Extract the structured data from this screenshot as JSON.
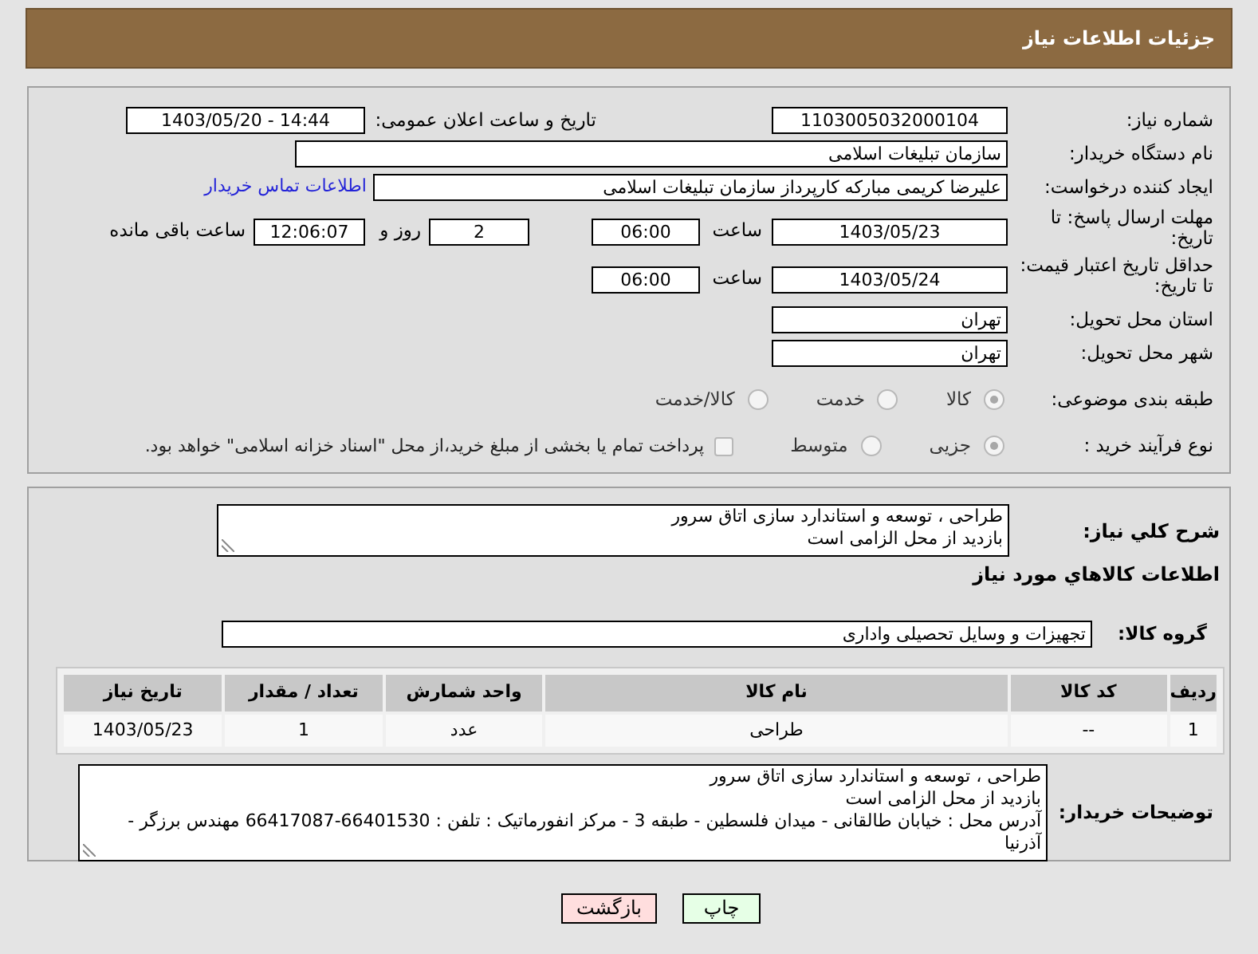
{
  "header": {
    "title": "جزئیات اطلاعات نیاز"
  },
  "need_number": {
    "label": "شماره نیاز:",
    "value": "1103005032000104"
  },
  "announce": {
    "label": "تاریخ و ساعت اعلان عمومی:",
    "value": "1403/05/20 - 14:44"
  },
  "buyer_org": {
    "label": "نام دستگاه خریدار:",
    "value": "سازمان تبلیغات اسلامی"
  },
  "requester": {
    "label": "ایجاد کننده درخواست:",
    "value": "علیرضا کریمی مبارکه کارپرداز سازمان تبلیغات اسلامی",
    "link": "اطلاعات تماس خریدار"
  },
  "reply_deadline": {
    "label": "مهلت ارسال پاسخ: تا تاریخ:",
    "date": "1403/05/23",
    "time_label": "ساعت",
    "time": "06:00",
    "days": "2",
    "days_label": "روز و",
    "remaining": "12:06:07",
    "remaining_label": "ساعت باقی مانده"
  },
  "price_validity": {
    "label": "حداقل تاریخ اعتبار قیمت: تا تاریخ:",
    "date": "1403/05/24",
    "time_label": "ساعت",
    "time": "06:00"
  },
  "province": {
    "label": "استان محل تحویل:",
    "value": "تهران"
  },
  "city": {
    "label": "شهر محل تحویل:",
    "value": "تهران"
  },
  "category": {
    "label": "طبقه بندی موضوعی:",
    "options": [
      {
        "label": "کالا",
        "selected": true
      },
      {
        "label": "خدمت",
        "selected": false
      },
      {
        "label": "کالا/خدمت",
        "selected": false
      }
    ]
  },
  "purchase_type": {
    "label": "نوع فرآیند خرید :",
    "options": [
      {
        "label": "جزیی",
        "selected": true
      },
      {
        "label": "متوسط",
        "selected": false
      }
    ],
    "payment": {
      "checked": false,
      "text": "پرداخت تمام یا بخشی از مبلغ خرید،از محل \"اسناد خزانه اسلامی\" خواهد بود."
    }
  },
  "description": {
    "label": "شرح کلي نياز:",
    "lines": [
      "طراحی ، توسعه و استاندارد سازی اتاق سرور",
      "بازدید از محل الزامی است"
    ]
  },
  "items_heading": "اطلاعات کالاهاي مورد نياز",
  "goods_group": {
    "label": "گروه کالا:",
    "value": "تجهیزات و وسایل تحصیلی واداری"
  },
  "table": {
    "columns": [
      "ردیف",
      "کد کالا",
      "نام کالا",
      "واحد شمارش",
      "تعداد / مقدار",
      "تاریخ نیاز"
    ],
    "rows": [
      [
        "1",
        "--",
        "طراحی",
        "عدد",
        "1",
        "1403/05/23"
      ]
    ]
  },
  "buyer_notes": {
    "label": "توضیحات خریدار:",
    "lines": [
      "طراحی ، توسعه و استاندارد سازی اتاق سرور",
      "بازدید از محل الزامی است",
      "آدرس محل : خیابان طالقانی - میدان فلسطین - طبقه 3 - مرکز انفورماتیک : تلفن : 66401530-66417087 مهندس برزگر - آذرنیا"
    ]
  },
  "buttons": [
    {
      "label": "چاپ",
      "kind": "print"
    },
    {
      "label": "بازگشت",
      "kind": "back"
    }
  ]
}
